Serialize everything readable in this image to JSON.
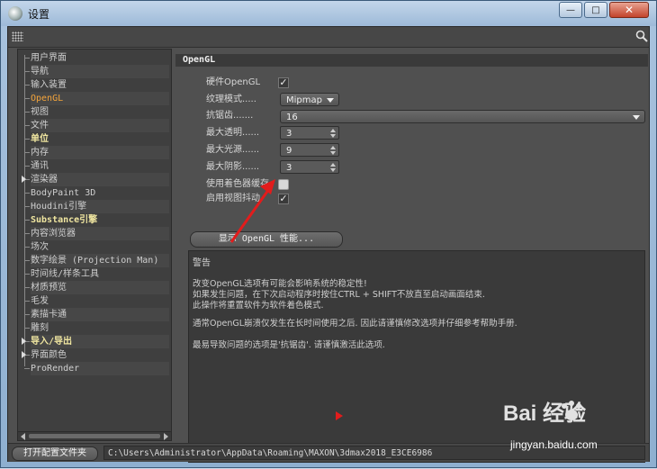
{
  "window": {
    "title": "设置",
    "close_glyph": "✕",
    "min_glyph": "—",
    "max_glyph": "□"
  },
  "sidebar": {
    "items": [
      {
        "label": "用户界面"
      },
      {
        "label": "导航"
      },
      {
        "label": "输入装置"
      },
      {
        "label": "OpenGL",
        "active": true
      },
      {
        "label": "视图"
      },
      {
        "label": "文件"
      },
      {
        "label": "单位",
        "bold": true
      },
      {
        "label": "内存"
      },
      {
        "label": "通讯"
      },
      {
        "label": "渲染器",
        "expandable": true
      },
      {
        "label": "BodyPaint 3D"
      },
      {
        "label": "Houdini引擎"
      },
      {
        "label": "Substance引擎",
        "bold": true
      },
      {
        "label": "内容浏览器"
      },
      {
        "label": "场次"
      },
      {
        "label": "数字绘景 (Projection Man)"
      },
      {
        "label": "时间线/样条工具"
      },
      {
        "label": "材质预览"
      },
      {
        "label": "毛发"
      },
      {
        "label": "素描卡通"
      },
      {
        "label": "雕刻"
      },
      {
        "label": "导入/导出",
        "bold": true,
        "expandable": true
      },
      {
        "label": "界面颜色",
        "expandable": true
      },
      {
        "label": "ProRender"
      }
    ]
  },
  "main": {
    "section_title": "OpenGL",
    "hardware_opengl": {
      "label": "硬件OpenGL",
      "checked": true,
      "check_glyph": "✓"
    },
    "texture_mode": {
      "label": "纹理模式.....",
      "value": "Mipmap"
    },
    "antialiasing": {
      "label": "抗锯齿.......",
      "value": "16"
    },
    "max_transparency": {
      "label": "最大透明......",
      "value": "3"
    },
    "max_lights": {
      "label": "最大光源......",
      "value": "9"
    },
    "max_shadows": {
      "label": "最大阴影......",
      "value": "3"
    },
    "shader_cache": {
      "label": "使用着色器缓存",
      "checked": false
    },
    "view_dither": {
      "label": "启用视图抖动",
      "checked": true,
      "check_glyph": "✓"
    },
    "perf_button": "显示 OpenGL 性能...",
    "warning": {
      "title": "警告",
      "lines": [
        "改变OpenGL选项有可能会影响系统的稳定性!",
        "如果发生问题，在下次启动程序时按住CTRL + SHIFT不放直至启动画面结束.",
        "此操作将重置软件为软件着色模式.",
        "通常OpenGL崩溃仅发生在长时间使用之后. 因此请谨慎修改选项并仔细参考帮助手册.",
        "最易导致问题的选项是'抗锯齿'. 请谨慎激活此选项."
      ]
    }
  },
  "status": {
    "open_folder_button": "打开配置文件夹",
    "path": "C:\\Users\\Administrator\\AppData\\Roaming\\MAXON\\3dmax2018_E3CE6986"
  },
  "watermark": {
    "brand": "Bai 经验",
    "url": "jingyan.baidu.com"
  },
  "colors": {
    "accent_active": "#f4a43a",
    "annotation_red": "#e21c1c",
    "panel_bg": "#505050"
  }
}
